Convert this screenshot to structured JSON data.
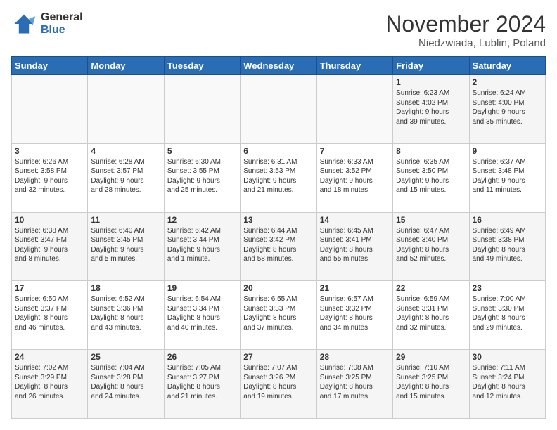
{
  "header": {
    "logo_general": "General",
    "logo_blue": "Blue",
    "month_title": "November 2024",
    "location": "Niedzwiada, Lublin, Poland"
  },
  "columns": [
    "Sunday",
    "Monday",
    "Tuesday",
    "Wednesday",
    "Thursday",
    "Friday",
    "Saturday"
  ],
  "weeks": [
    [
      {
        "day": "",
        "info": ""
      },
      {
        "day": "",
        "info": ""
      },
      {
        "day": "",
        "info": ""
      },
      {
        "day": "",
        "info": ""
      },
      {
        "day": "",
        "info": ""
      },
      {
        "day": "1",
        "info": "Sunrise: 6:23 AM\nSunset: 4:02 PM\nDaylight: 9 hours\nand 39 minutes."
      },
      {
        "day": "2",
        "info": "Sunrise: 6:24 AM\nSunset: 4:00 PM\nDaylight: 9 hours\nand 35 minutes."
      }
    ],
    [
      {
        "day": "3",
        "info": "Sunrise: 6:26 AM\nSunset: 3:58 PM\nDaylight: 9 hours\nand 32 minutes."
      },
      {
        "day": "4",
        "info": "Sunrise: 6:28 AM\nSunset: 3:57 PM\nDaylight: 9 hours\nand 28 minutes."
      },
      {
        "day": "5",
        "info": "Sunrise: 6:30 AM\nSunset: 3:55 PM\nDaylight: 9 hours\nand 25 minutes."
      },
      {
        "day": "6",
        "info": "Sunrise: 6:31 AM\nSunset: 3:53 PM\nDaylight: 9 hours\nand 21 minutes."
      },
      {
        "day": "7",
        "info": "Sunrise: 6:33 AM\nSunset: 3:52 PM\nDaylight: 9 hours\nand 18 minutes."
      },
      {
        "day": "8",
        "info": "Sunrise: 6:35 AM\nSunset: 3:50 PM\nDaylight: 9 hours\nand 15 minutes."
      },
      {
        "day": "9",
        "info": "Sunrise: 6:37 AM\nSunset: 3:48 PM\nDaylight: 9 hours\nand 11 minutes."
      }
    ],
    [
      {
        "day": "10",
        "info": "Sunrise: 6:38 AM\nSunset: 3:47 PM\nDaylight: 9 hours\nand 8 minutes."
      },
      {
        "day": "11",
        "info": "Sunrise: 6:40 AM\nSunset: 3:45 PM\nDaylight: 9 hours\nand 5 minutes."
      },
      {
        "day": "12",
        "info": "Sunrise: 6:42 AM\nSunset: 3:44 PM\nDaylight: 9 hours\nand 1 minute."
      },
      {
        "day": "13",
        "info": "Sunrise: 6:44 AM\nSunset: 3:42 PM\nDaylight: 8 hours\nand 58 minutes."
      },
      {
        "day": "14",
        "info": "Sunrise: 6:45 AM\nSunset: 3:41 PM\nDaylight: 8 hours\nand 55 minutes."
      },
      {
        "day": "15",
        "info": "Sunrise: 6:47 AM\nSunset: 3:40 PM\nDaylight: 8 hours\nand 52 minutes."
      },
      {
        "day": "16",
        "info": "Sunrise: 6:49 AM\nSunset: 3:38 PM\nDaylight: 8 hours\nand 49 minutes."
      }
    ],
    [
      {
        "day": "17",
        "info": "Sunrise: 6:50 AM\nSunset: 3:37 PM\nDaylight: 8 hours\nand 46 minutes."
      },
      {
        "day": "18",
        "info": "Sunrise: 6:52 AM\nSunset: 3:36 PM\nDaylight: 8 hours\nand 43 minutes."
      },
      {
        "day": "19",
        "info": "Sunrise: 6:54 AM\nSunset: 3:34 PM\nDaylight: 8 hours\nand 40 minutes."
      },
      {
        "day": "20",
        "info": "Sunrise: 6:55 AM\nSunset: 3:33 PM\nDaylight: 8 hours\nand 37 minutes."
      },
      {
        "day": "21",
        "info": "Sunrise: 6:57 AM\nSunset: 3:32 PM\nDaylight: 8 hours\nand 34 minutes."
      },
      {
        "day": "22",
        "info": "Sunrise: 6:59 AM\nSunset: 3:31 PM\nDaylight: 8 hours\nand 32 minutes."
      },
      {
        "day": "23",
        "info": "Sunrise: 7:00 AM\nSunset: 3:30 PM\nDaylight: 8 hours\nand 29 minutes."
      }
    ],
    [
      {
        "day": "24",
        "info": "Sunrise: 7:02 AM\nSunset: 3:29 PM\nDaylight: 8 hours\nand 26 minutes."
      },
      {
        "day": "25",
        "info": "Sunrise: 7:04 AM\nSunset: 3:28 PM\nDaylight: 8 hours\nand 24 minutes."
      },
      {
        "day": "26",
        "info": "Sunrise: 7:05 AM\nSunset: 3:27 PM\nDaylight: 8 hours\nand 21 minutes."
      },
      {
        "day": "27",
        "info": "Sunrise: 7:07 AM\nSunset: 3:26 PM\nDaylight: 8 hours\nand 19 minutes."
      },
      {
        "day": "28",
        "info": "Sunrise: 7:08 AM\nSunset: 3:25 PM\nDaylight: 8 hours\nand 17 minutes."
      },
      {
        "day": "29",
        "info": "Sunrise: 7:10 AM\nSunset: 3:25 PM\nDaylight: 8 hours\nand 15 minutes."
      },
      {
        "day": "30",
        "info": "Sunrise: 7:11 AM\nSunset: 3:24 PM\nDaylight: 8 hours\nand 12 minutes."
      }
    ]
  ]
}
